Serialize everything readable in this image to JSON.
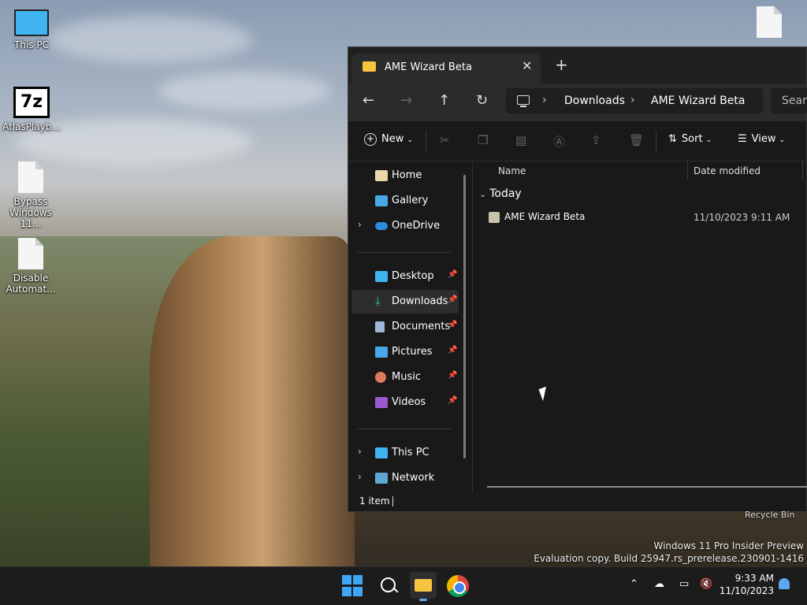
{
  "desktop": {
    "icons": [
      {
        "label": "This PC"
      },
      {
        "label": "AtlasPlayb..."
      },
      {
        "label": "Bypass Windows 11..."
      },
      {
        "label": "Disable Automat..."
      }
    ],
    "recycle_bin": "Recycle Bin",
    "watermark_line1": "Windows 11 Pro Insider Preview",
    "watermark_line2": "Evaluation copy. Build 25947.rs_prerelease.230901-1416"
  },
  "explorer": {
    "tab_title": "AME Wizard Beta",
    "address": {
      "crumbs": [
        "Downloads",
        "AME Wizard Beta"
      ]
    },
    "search_placeholder": "Searc",
    "toolbar": {
      "new": "New",
      "sort": "Sort",
      "view": "View"
    },
    "sidebar": {
      "home": "Home",
      "gallery": "Gallery",
      "onedrive": "OneDrive",
      "desktop": "Desktop",
      "downloads": "Downloads",
      "documents": "Documents",
      "pictures": "Pictures",
      "music": "Music",
      "videos": "Videos",
      "thispc": "This PC",
      "network": "Network"
    },
    "columns": {
      "name": "Name",
      "date": "Date modified"
    },
    "group": "Today",
    "files": [
      {
        "name": "AME Wizard Beta",
        "date": "11/10/2023 9:11 AM"
      }
    ],
    "status": "1 item"
  },
  "taskbar": {
    "time": "9:33 AM",
    "date": "11/10/2023"
  },
  "colors": {
    "accent": "#3fa6f5",
    "folder": "#f5c542"
  }
}
